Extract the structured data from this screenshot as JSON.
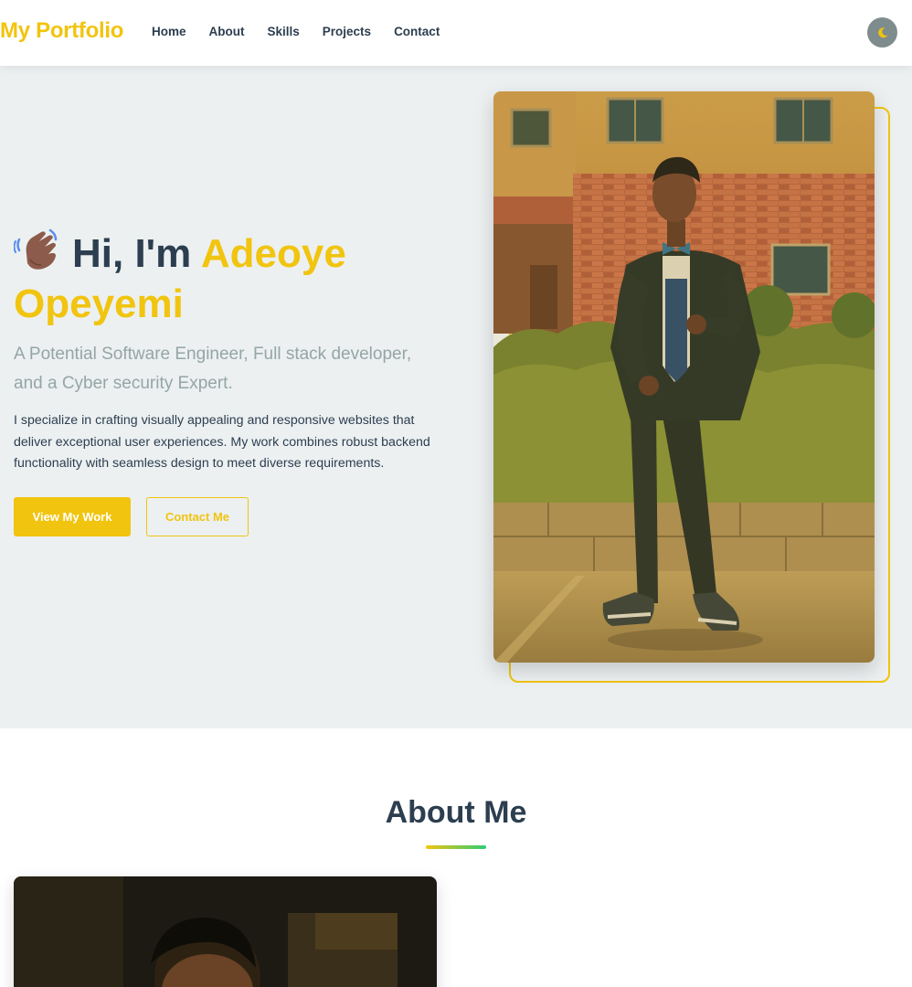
{
  "navbar": {
    "brand": "My Portfolio",
    "links": [
      "Home",
      "About",
      "Skills",
      "Projects",
      "Contact"
    ],
    "theme_icon": "moon-icon"
  },
  "hero": {
    "greeting": "Hi, I'm",
    "name_first": "Adeoye",
    "name_last": "Opeyemi",
    "wave_icon": "waving-hand-icon",
    "subtitle": "A Potential Software Engineer, Full stack developer, and a Cyber security Expert.",
    "description": "I specialize in crafting visually appealing and responsive websites that deliver exceptional user experiences. My work combines robust backend functionality with seamless design to meet diverse requirements.",
    "primary_button": "View My Work",
    "secondary_button": "Contact Me"
  },
  "about": {
    "title": "About Me"
  },
  "colors": {
    "accent": "#f1c40f",
    "text_dark": "#2c3e50",
    "text_muted": "#95a5a6",
    "hero_bg": "#ecf0f1",
    "gradient_end": "#2ecc71"
  }
}
